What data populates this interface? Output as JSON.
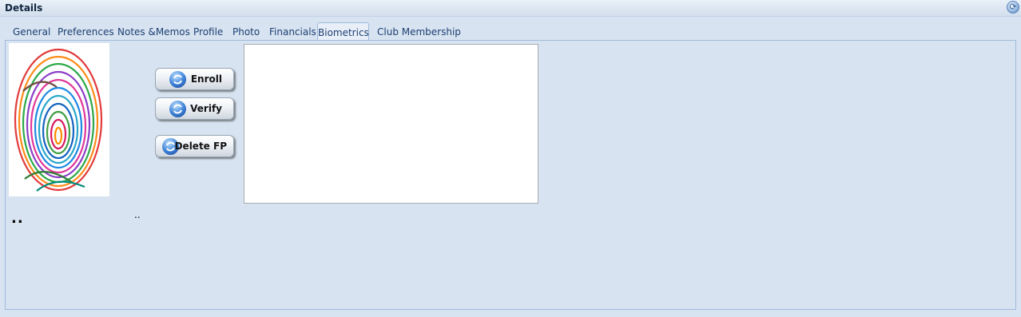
{
  "header": {
    "title": "Details",
    "refresh_icon": "refresh-icon"
  },
  "tabs": [
    {
      "label": "General"
    },
    {
      "label": "Preferences"
    },
    {
      "label": "Notes &Memos"
    },
    {
      "label": "Profile"
    },
    {
      "label": "Photo"
    },
    {
      "label": "Financials"
    },
    {
      "label": "Biometrics",
      "active": true
    },
    {
      "label": "Club Membership"
    }
  ],
  "biometrics": {
    "fingerprint_image": "fingerprint-image",
    "buttons": {
      "enroll": "Enroll",
      "verify": "Verify",
      "delete": "Delete FP"
    },
    "button_icon": "refresh-arrows-icon",
    "status_left": "..",
    "status_right": ".."
  },
  "colors": {
    "tab_text": "#1d3f73",
    "panel_bg": "#d7e3f0",
    "border": "#9fb9db"
  }
}
